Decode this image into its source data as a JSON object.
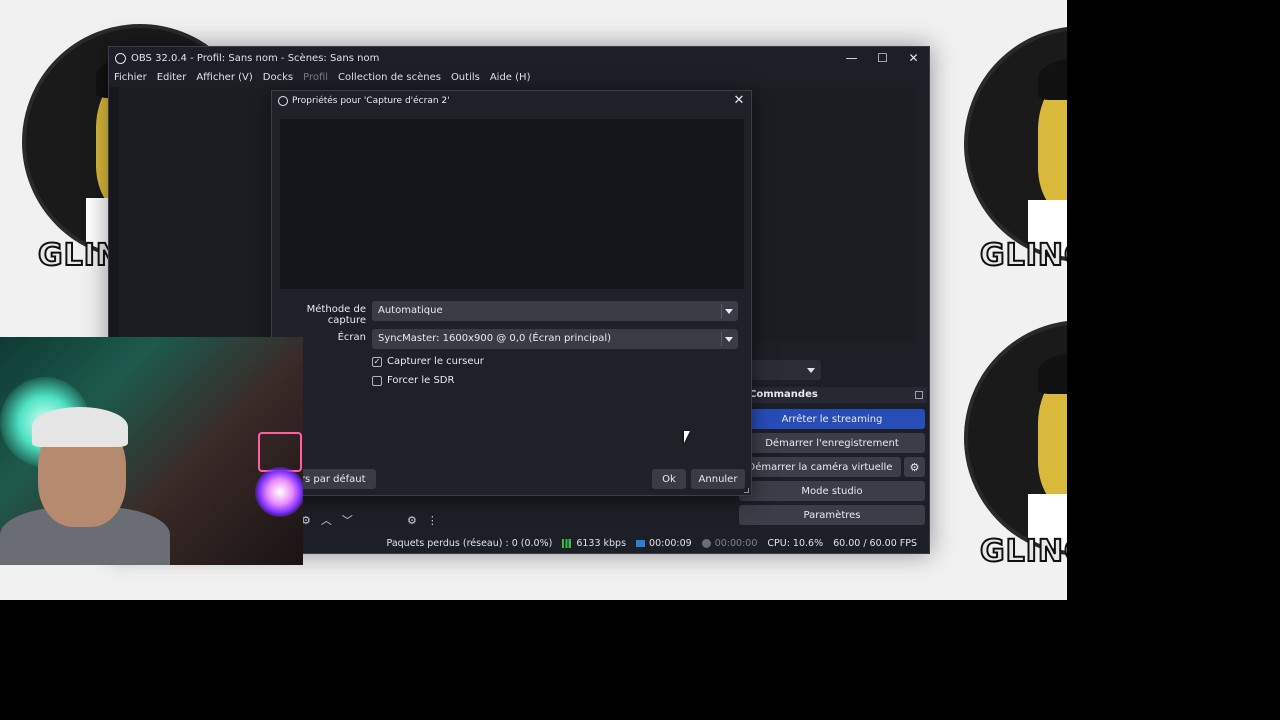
{
  "background": {
    "brand_text": "GLING"
  },
  "obs_window": {
    "title": "OBS 32.0.4 - Profil: Sans nom - Scènes: Sans nom",
    "window_controls": {
      "minimize": "—",
      "maximize": "☐",
      "close": "✕"
    },
    "menu": [
      "Fichier",
      "Editer",
      "Afficher (V)",
      "Docks",
      "Profil",
      "Collection de scènes",
      "Outils",
      "Aide (H)"
    ],
    "controls_dock": {
      "title": "Commandes",
      "buttons": {
        "stop_streaming": "Arrêter le streaming",
        "start_recording": "Démarrer l'enregistrement",
        "start_virtual_cam": "Démarrer la caméra virtuelle",
        "studio_mode": "Mode studio",
        "settings": "Paramètres"
      }
    },
    "status": {
      "dropped_frames": "Paquets perdus (réseau) : 0 (0.0%)",
      "bitrate": "6133 kbps",
      "stream_time": "00:00:09",
      "record_time": "00:00:00",
      "cpu": "CPU: 10.6%",
      "fps": "60.00 / 60.00 FPS"
    }
  },
  "dialog": {
    "title": "Propriétés pour 'Capture d'écran 2'",
    "close": "✕",
    "capture_method": {
      "label": "Méthode de capture",
      "value": "Automatique"
    },
    "screen": {
      "label": "Écran",
      "value": "SyncMaster: 1600x900 @ 0,0 (Écran principal)"
    },
    "capture_cursor": {
      "label": "Capturer le curseur",
      "checked": true
    },
    "force_sdr": {
      "label": "Forcer le SDR",
      "checked": false
    },
    "defaults_button": "eurs par défaut",
    "ok_button": "Ok",
    "cancel_button": "Annuler"
  },
  "icons": {
    "gear": "⚙",
    "check": "✓",
    "up": "︿",
    "down": "﹀",
    "more": "⋮"
  },
  "colors": {
    "accent_blue": "#284cb8",
    "window_bg": "#1d1f26",
    "dialog_bg": "#1f2028"
  }
}
